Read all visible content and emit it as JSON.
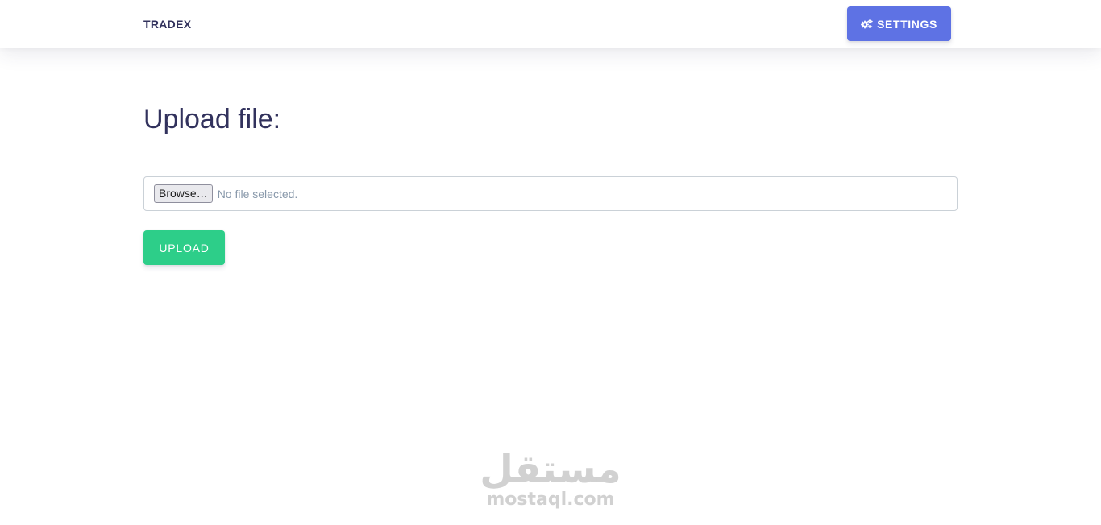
{
  "navbar": {
    "brand": "TRADEX",
    "settings_label": "SETTINGS",
    "settings_icon": "cogs-icon"
  },
  "main": {
    "title": "Upload file:",
    "file_input": {
      "browse_label": "Browse…",
      "status": "No file selected."
    },
    "upload_label": "UPLOAD"
  },
  "watermark": {
    "arabic": "مستقل",
    "latin": "mostaql.com"
  },
  "colors": {
    "primary": "#5e72e4",
    "success": "#2dce89",
    "text": "#32325d",
    "muted": "#8898aa"
  }
}
